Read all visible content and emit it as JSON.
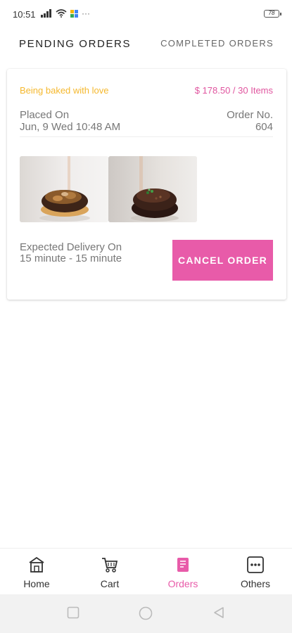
{
  "status_bar": {
    "time": "10:51",
    "dots": "···",
    "battery": "78"
  },
  "tabs": {
    "pending": "PENDING ORDERS",
    "completed": "COMPLETED ORDERS"
  },
  "order": {
    "status": "Being baked with love",
    "price_items": "$ 178.50 / 30 Items",
    "placed_label": "Placed On",
    "placed_date": "Jun, 9 Wed 10:48 AM",
    "order_no_label": "Order No.",
    "order_no": "604",
    "delivery_label": "Expected Delivery On",
    "delivery_time": "15 minute - 15 minute",
    "cancel_label": "CANCEL ORDER"
  },
  "bottom_nav": {
    "items": [
      {
        "label": "Home",
        "icon": "home-icon"
      },
      {
        "label": "Cart",
        "icon": "cart-icon"
      },
      {
        "label": "Orders",
        "icon": "orders-icon",
        "active": true
      },
      {
        "label": "Others",
        "icon": "more-icon"
      }
    ]
  },
  "colors": {
    "accent": "#e85ba9",
    "status_yellow": "#f5b82e"
  }
}
